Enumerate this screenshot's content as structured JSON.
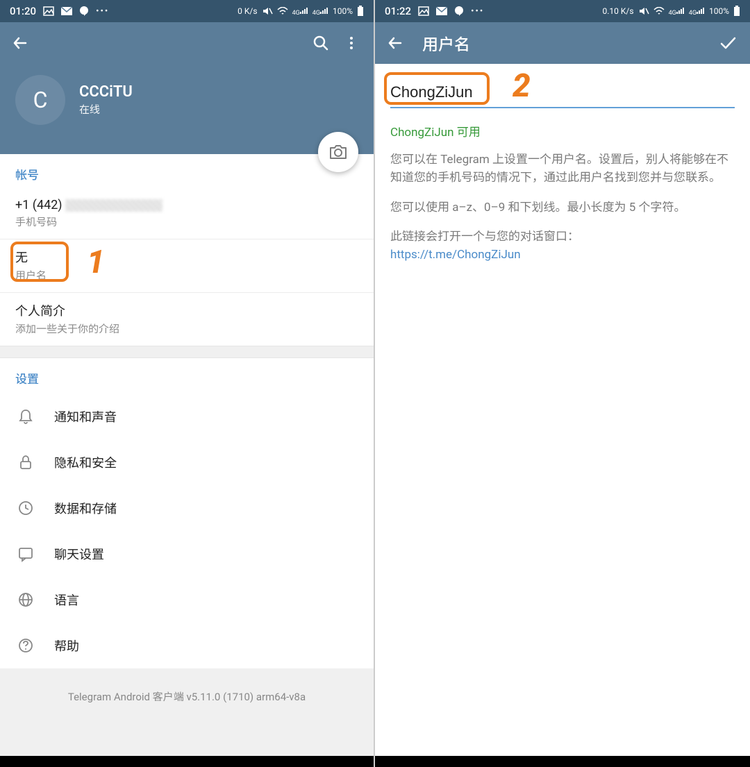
{
  "left": {
    "status": {
      "time": "01:20",
      "net": "0 K/s",
      "battery": "100%",
      "sig": "4G"
    },
    "profile": {
      "name": "CCCiTU",
      "status": "在线",
      "avatar_letter": "C"
    },
    "account": {
      "label": "帐号",
      "phone_prefix": "+1 (442) ",
      "phone_label": "手机号码",
      "username_value": "无",
      "username_label": "用户名",
      "bio_value": "个人简介",
      "bio_label": "添加一些关于你的介绍"
    },
    "settings": {
      "label": "设置",
      "items": [
        {
          "label": "通知和声音",
          "icon": "bell"
        },
        {
          "label": "隐私和安全",
          "icon": "lock"
        },
        {
          "label": "数据和存储",
          "icon": "clock"
        },
        {
          "label": "聊天设置",
          "icon": "chat"
        },
        {
          "label": "语言",
          "icon": "globe"
        },
        {
          "label": "帮助",
          "icon": "help"
        }
      ]
    },
    "version": "Telegram Android 客户端 v5.11.0 (1710) arm64-v8a",
    "marker": "1"
  },
  "right": {
    "status": {
      "time": "01:22",
      "net": "0.10 K/s",
      "battery": "100%",
      "sig": "4G"
    },
    "title": "用户名",
    "input_value": "ChongZiJun",
    "availability": "ChongZiJun 可用",
    "info1": "您可以在 Telegram 上设置一个用户名。设置后，别人将能够在不知道您的手机号码的情况下，通过此用户名找到您并与您联系。",
    "info2": "您可以使用 a–z、0–9 和下划线。最小长度为 5 个字符。",
    "info3": "此链接会打开一个与您的对话窗口：",
    "link": "https://t.me/ChongZiJun",
    "marker": "2"
  }
}
